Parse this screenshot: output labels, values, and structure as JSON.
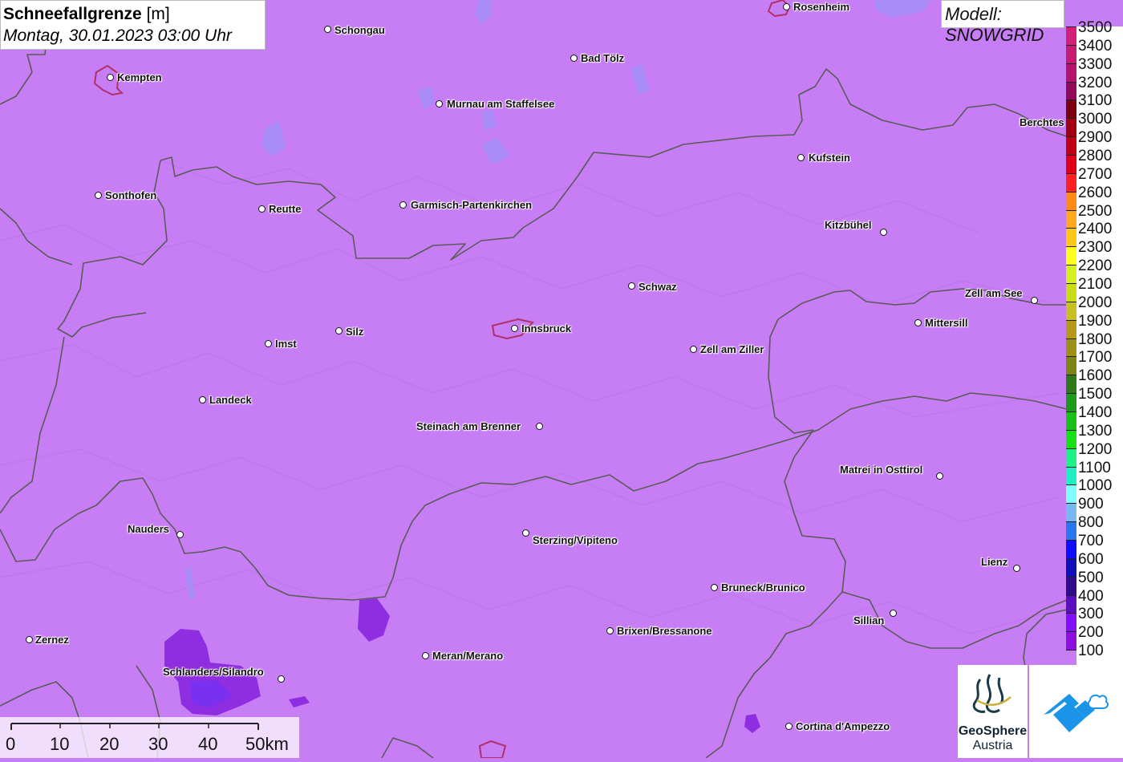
{
  "title": {
    "name": "Schneefallgrenze",
    "unit": "[m]",
    "datetime": "Montag, 30.01.2023 03:00 Uhr"
  },
  "model_label": "Modell: SNOWGRID",
  "cities": [
    {
      "name": "Rosenheim",
      "label_side": "right"
    },
    {
      "name": "Schongau",
      "label_side": "right"
    },
    {
      "name": "Bad Tölz",
      "label_side": "right"
    },
    {
      "name": "Kempten",
      "label_side": "right"
    },
    {
      "name": "Murnau am Staffelsee",
      "label_side": "right"
    },
    {
      "name": "Berchtes",
      "label_side": "left"
    },
    {
      "name": "Kufstein",
      "label_side": "right"
    },
    {
      "name": "Sonthofen",
      "label_side": "right"
    },
    {
      "name": "Reutte",
      "label_side": "right"
    },
    {
      "name": "Garmisch-Partenkirchen",
      "label_side": "right"
    },
    {
      "name": "Kitzbühel",
      "label_side": "left"
    },
    {
      "name": "Schwaz",
      "label_side": "right"
    },
    {
      "name": "Zell am See",
      "label_side": "left"
    },
    {
      "name": "Mittersill",
      "label_side": "right"
    },
    {
      "name": "Innsbruck",
      "label_side": "right"
    },
    {
      "name": "Silz",
      "label_side": "right"
    },
    {
      "name": "Imst",
      "label_side": "right"
    },
    {
      "name": "Zell am Ziller",
      "label_side": "right"
    },
    {
      "name": "Landeck",
      "label_side": "right"
    },
    {
      "name": "Steinach am Brenner",
      "label_side": "left"
    },
    {
      "name": "Matrei in Osttirol",
      "label_side": "left"
    },
    {
      "name": "Nauders",
      "label_side": "left"
    },
    {
      "name": "Sterzing/Vipiteno",
      "label_side": "right"
    },
    {
      "name": "Lienz",
      "label_side": "left"
    },
    {
      "name": "Bruneck/Brunico",
      "label_side": "right"
    },
    {
      "name": "Sillian",
      "label_side": "left"
    },
    {
      "name": "Brixen/Bressanone",
      "label_side": "right"
    },
    {
      "name": "Zernez",
      "label_side": "right"
    },
    {
      "name": "Meran/Merano",
      "label_side": "right"
    },
    {
      "name": "Schlanders/Silandro",
      "label_side": "left"
    },
    {
      "name": "Cortina d'Ampezzo",
      "label_side": "right"
    }
  ],
  "legend": {
    "unit": "m",
    "classes": [
      {
        "value": "3500",
        "color": "#d0207a"
      },
      {
        "value": "3400",
        "color": "#c81c72"
      },
      {
        "value": "3300",
        "color": "#b5146a"
      },
      {
        "value": "3200",
        "color": "#900a5a"
      },
      {
        "value": "3100",
        "color": "#7a0010"
      },
      {
        "value": "3000",
        "color": "#a00010"
      },
      {
        "value": "2900",
        "color": "#c00014"
      },
      {
        "value": "2800",
        "color": "#e0001a"
      },
      {
        "value": "2700",
        "color": "#ff2020"
      },
      {
        "value": "2600",
        "color": "#ff8a18"
      },
      {
        "value": "2500",
        "color": "#ffa820"
      },
      {
        "value": "2400",
        "color": "#ffc818"
      },
      {
        "value": "2300",
        "color": "#ffff20"
      },
      {
        "value": "2200",
        "color": "#d4f020"
      },
      {
        "value": "2100",
        "color": "#c8dc18"
      },
      {
        "value": "2000",
        "color": "#c8c020"
      },
      {
        "value": "1900",
        "color": "#b89818"
      },
      {
        "value": "1800",
        "color": "#9c9018"
      },
      {
        "value": "1700",
        "color": "#7c8414"
      },
      {
        "value": "1600",
        "color": "#2e7a18"
      },
      {
        "value": "1500",
        "color": "#1a9a18"
      },
      {
        "value": "1400",
        "color": "#18c018"
      },
      {
        "value": "1300",
        "color": "#18e018"
      },
      {
        "value": "1200",
        "color": "#20f088"
      },
      {
        "value": "1100",
        "color": "#20f0c0"
      },
      {
        "value": "1000",
        "color": "#80ffff"
      },
      {
        "value": "900",
        "color": "#78b8f0"
      },
      {
        "value": "800",
        "color": "#2878f0"
      },
      {
        "value": "700",
        "color": "#1010f8"
      },
      {
        "value": "600",
        "color": "#1010b8"
      },
      {
        "value": "500",
        "color": "#300c88"
      },
      {
        "value": "400",
        "color": "#5a10c0"
      },
      {
        "value": "300",
        "color": "#8010f8"
      },
      {
        "value": "200",
        "color": "#8c10e0"
      },
      {
        "value": "100",
        "color": "#c77ef5"
      }
    ]
  },
  "scale_bar": {
    "labels": [
      "0",
      "10",
      "20",
      "30",
      "40",
      "50km"
    ]
  },
  "logos": {
    "geosphere_name": "GeoSphere",
    "geosphere_sub": "Austria"
  },
  "colors": {
    "map_background": "#c77ef5",
    "border": "#555555",
    "lake": "#a98cf7",
    "low_zone": "#8f2ee0"
  }
}
